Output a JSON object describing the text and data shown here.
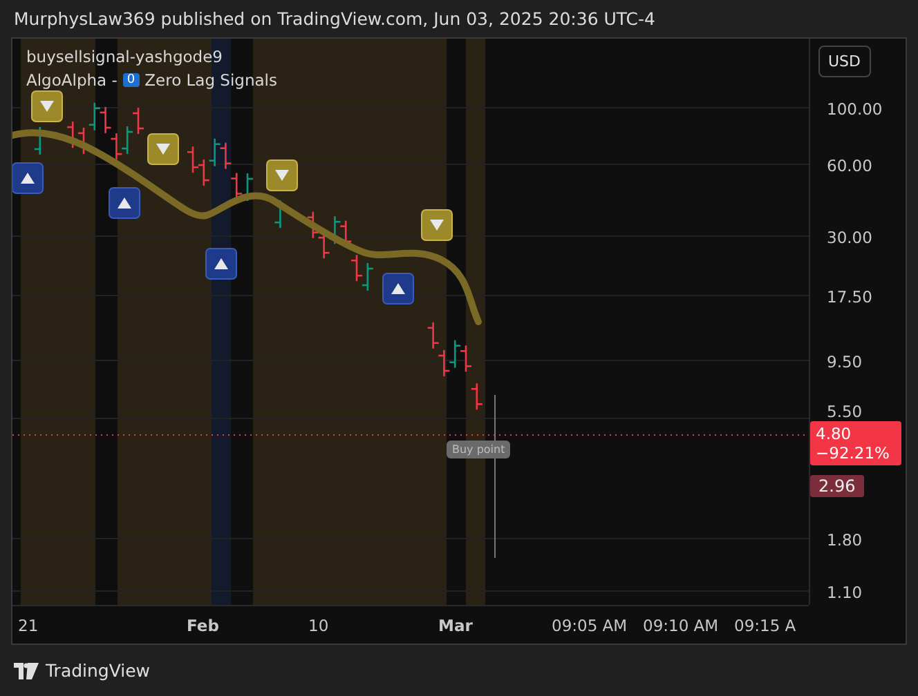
{
  "header": {
    "text": "MurphysLaw369 published on TradingView.com, Jun 03, 2025 20:36 UTC-4"
  },
  "legend": {
    "title": "buysellsignal-yashgode9",
    "indicator_prefix": "AlgoAlpha -",
    "badge": "0",
    "indicator_name": "Zero Lag Signals"
  },
  "currency_button": {
    "label": "USD"
  },
  "price_axis": {
    "labels": [
      "100.00",
      "60.00",
      "30.00",
      "17.50",
      "9.50",
      "5.50",
      "1.80",
      "1.10"
    ]
  },
  "last_price": {
    "price": "4.80",
    "change": "−92.21%"
  },
  "secondary_price": {
    "price": "2.96"
  },
  "tooltip": {
    "text": "Buy point"
  },
  "time_axis": {
    "labels": [
      {
        "text": "21",
        "bold": false
      },
      {
        "text": "Feb",
        "bold": true
      },
      {
        "text": "10",
        "bold": false
      },
      {
        "text": "Mar",
        "bold": true
      },
      {
        "text": "09:05 AM",
        "bold": false
      },
      {
        "text": "09:10 AM",
        "bold": false
      },
      {
        "text": "09:15 A",
        "bold": false
      }
    ]
  },
  "footer": {
    "brand": "TradingView"
  }
}
